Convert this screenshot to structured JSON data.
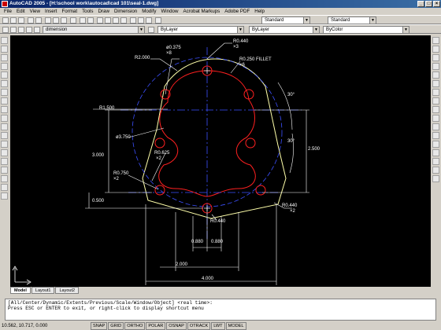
{
  "window": {
    "title": "AutoCAD 2005 - [H:\\school work\\autocad\\cad 101\\seal-1.dwg]",
    "buttons": [
      "_",
      "□",
      "×"
    ]
  },
  "menu": [
    "File",
    "Edit",
    "View",
    "Insert",
    "Format",
    "Tools",
    "Draw",
    "Dimension",
    "Modify",
    "Window",
    "Acrobat Markups",
    "Adobe PDF",
    "Help"
  ],
  "toolbar": {
    "style_combo_1": "Standard",
    "style_combo_2": "Standard",
    "dim_style": "dimension",
    "color": "ByLayer",
    "linetype": "ByLayer",
    "lineweight": "ByColor"
  },
  "drawing": {
    "colors": {
      "background": "#000000",
      "object": "#ff2020",
      "hidden": "#3c50ff",
      "outline": "#ffffaa",
      "dimension": "#ffffff"
    },
    "labels": {
      "r0440_top": "R0.440",
      "x3": "×3",
      "dia0375": "ø0.375",
      "x8": "×8",
      "r2000": "R2.000",
      "r0250": "R0.250 FILLET",
      "x6": "×6",
      "r1500": "R1.500",
      "dia3750": "ø3.750",
      "r0625": "R0.625",
      "x2a": "×2",
      "r0750": "R0.750",
      "x2b": "×2",
      "r0440_right": "R0.440",
      "x2c": "×2",
      "r0440_bottom": "R0.440",
      "ang30a": "30°",
      "ang30b": "30°",
      "d3000": "3.000",
      "d0500": "0.500",
      "d2500": "2.500",
      "d0880a": "0.880",
      "d0880b": "0.880",
      "d2000": "2.000",
      "d4000": "4.000"
    }
  },
  "tabs": [
    "Model",
    "Layout1",
    "Layout2"
  ],
  "command": {
    "line1": "[All/Center/Dynamic/Extents/Previous/Scale/Window/Object] <real time>:",
    "line2": "Press ESC or ENTER to exit, or right-click to display shortcut menu",
    "line3": ""
  },
  "status": {
    "coords": "10.562, 10.717, 0.000",
    "toggles": [
      "SNAP",
      "GRID",
      "ORTHO",
      "POLAR",
      "OSNAP",
      "OTRACK",
      "LWT",
      "MODEL"
    ]
  }
}
